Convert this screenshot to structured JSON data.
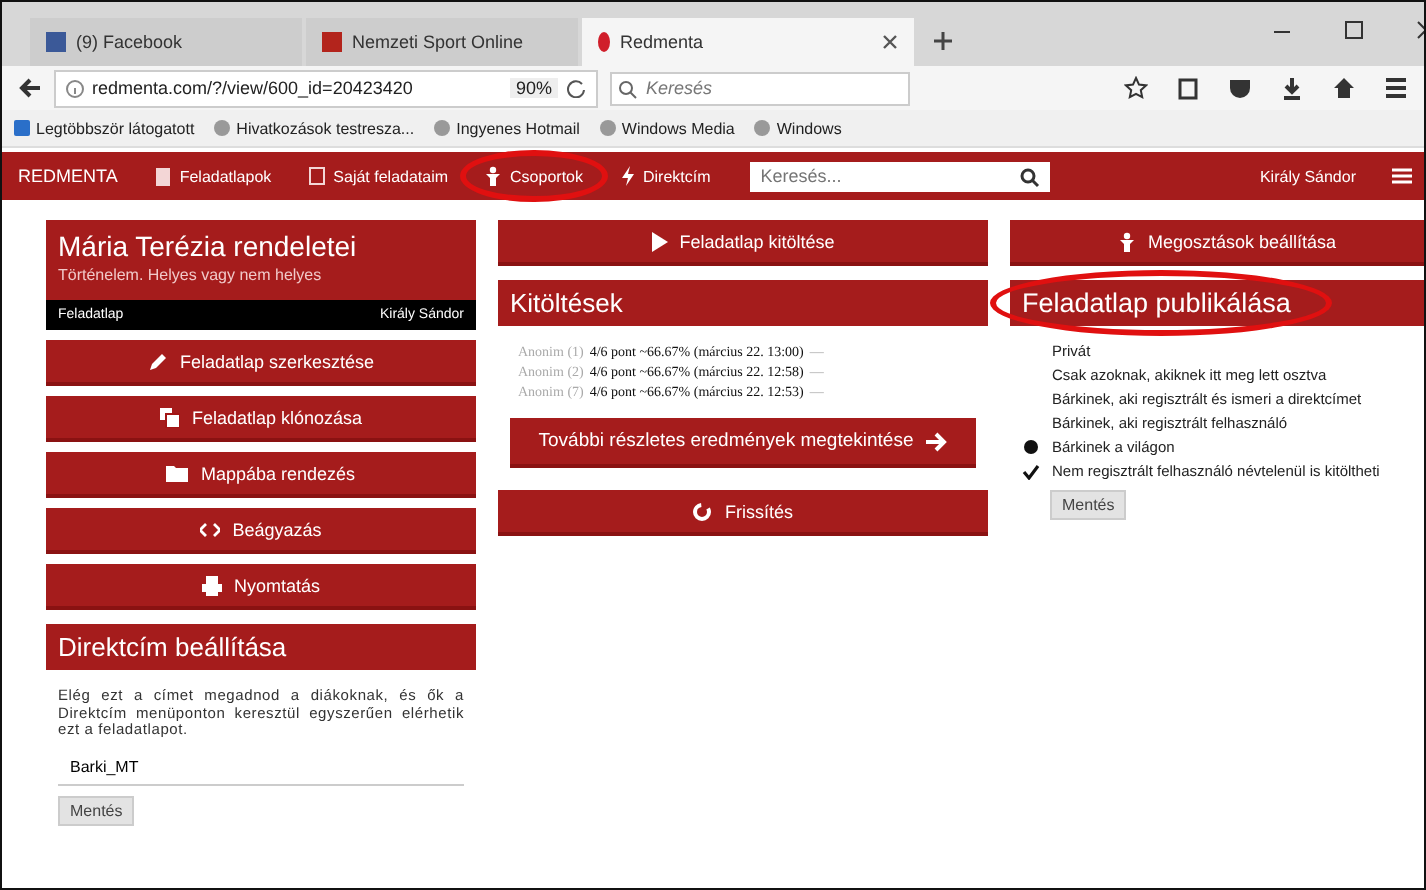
{
  "browser": {
    "tabs": [
      {
        "label": "(9) Facebook",
        "selected": false
      },
      {
        "label": "Nemzeti Sport Online",
        "selected": false
      },
      {
        "label": "Redmenta",
        "selected": true
      }
    ],
    "url": "redmenta.com/?/view/600_id=20423420",
    "zoom": "90%",
    "search_placeholder": "Keresés",
    "bookmarks": [
      "Legtöbbször látogatott",
      "Hivatkozások testresza...",
      "Ingyenes Hotmail",
      "Windows Media",
      "Windows"
    ]
  },
  "navbar": {
    "brand": "REDMENTA",
    "items": [
      {
        "label": "Feladatlapok",
        "highlighted": false
      },
      {
        "label": "Saját feladataim",
        "highlighted": false
      },
      {
        "label": "Csoportok",
        "highlighted": true
      },
      {
        "label": "Direktcím",
        "highlighted": false
      }
    ],
    "search_placeholder": "Keresés...",
    "user": "Király Sándor"
  },
  "sheet": {
    "title": "Mária Terézia rendeletei",
    "subtitle": "Történelem. Helyes vagy nem helyes",
    "type": "Feladatlap",
    "author": "Király Sándor"
  },
  "actions": [
    "Feladatlap szerkesztése",
    "Feladatlap klónozása",
    "Mappába rendezés",
    "Beágyazás",
    "Nyomtatás"
  ],
  "direct": {
    "title": "Direktcím beállítása",
    "text": "Elég ezt a címet megadnod a diákoknak, és ők a Direktcím menüponton keresztül egyszerűen elérhetik ezt a feladatlapot.",
    "value": "Barki_MT",
    "button": "Mentés"
  },
  "fill_button": "Feladatlap kitöltése",
  "attempts": {
    "title": "Kitöltések",
    "rows": [
      {
        "name": "Anonim (1)",
        "result": "4/6 pont ~66.67% (március 22. 13:00)",
        "trail": "—"
      },
      {
        "name": "Anonim (2)",
        "result": "4/6 pont ~66.67% (március 22. 12:58)",
        "trail": "—"
      },
      {
        "name": "Anonim (7)",
        "result": "4/6 pont ~66.67% (március 22. 12:53)",
        "trail": "—"
      }
    ],
    "more_button": "További részletes eredmények megtekintése",
    "refresh_button": "Frissítés"
  },
  "share_button": "Megosztások beállítása",
  "publish": {
    "title": "Feladatlap publikálása",
    "highlighted": true,
    "options": [
      {
        "label": "Privát",
        "selected": false
      },
      {
        "label": "Csak azoknak, akiknek itt meg lett osztva",
        "selected": false
      },
      {
        "label": "Bárkinek, aki regisztrált és ismeri a direktcímet",
        "selected": false
      },
      {
        "label": "Bárkinek, aki regisztrált felhasználó",
        "selected": false
      },
      {
        "label": "Bárkinek a világon",
        "selected": true
      }
    ],
    "anonymous": {
      "label": "Nem regisztrált felhasználó névtelenül is kitöltheti",
      "checked": true
    },
    "button": "Mentés"
  }
}
